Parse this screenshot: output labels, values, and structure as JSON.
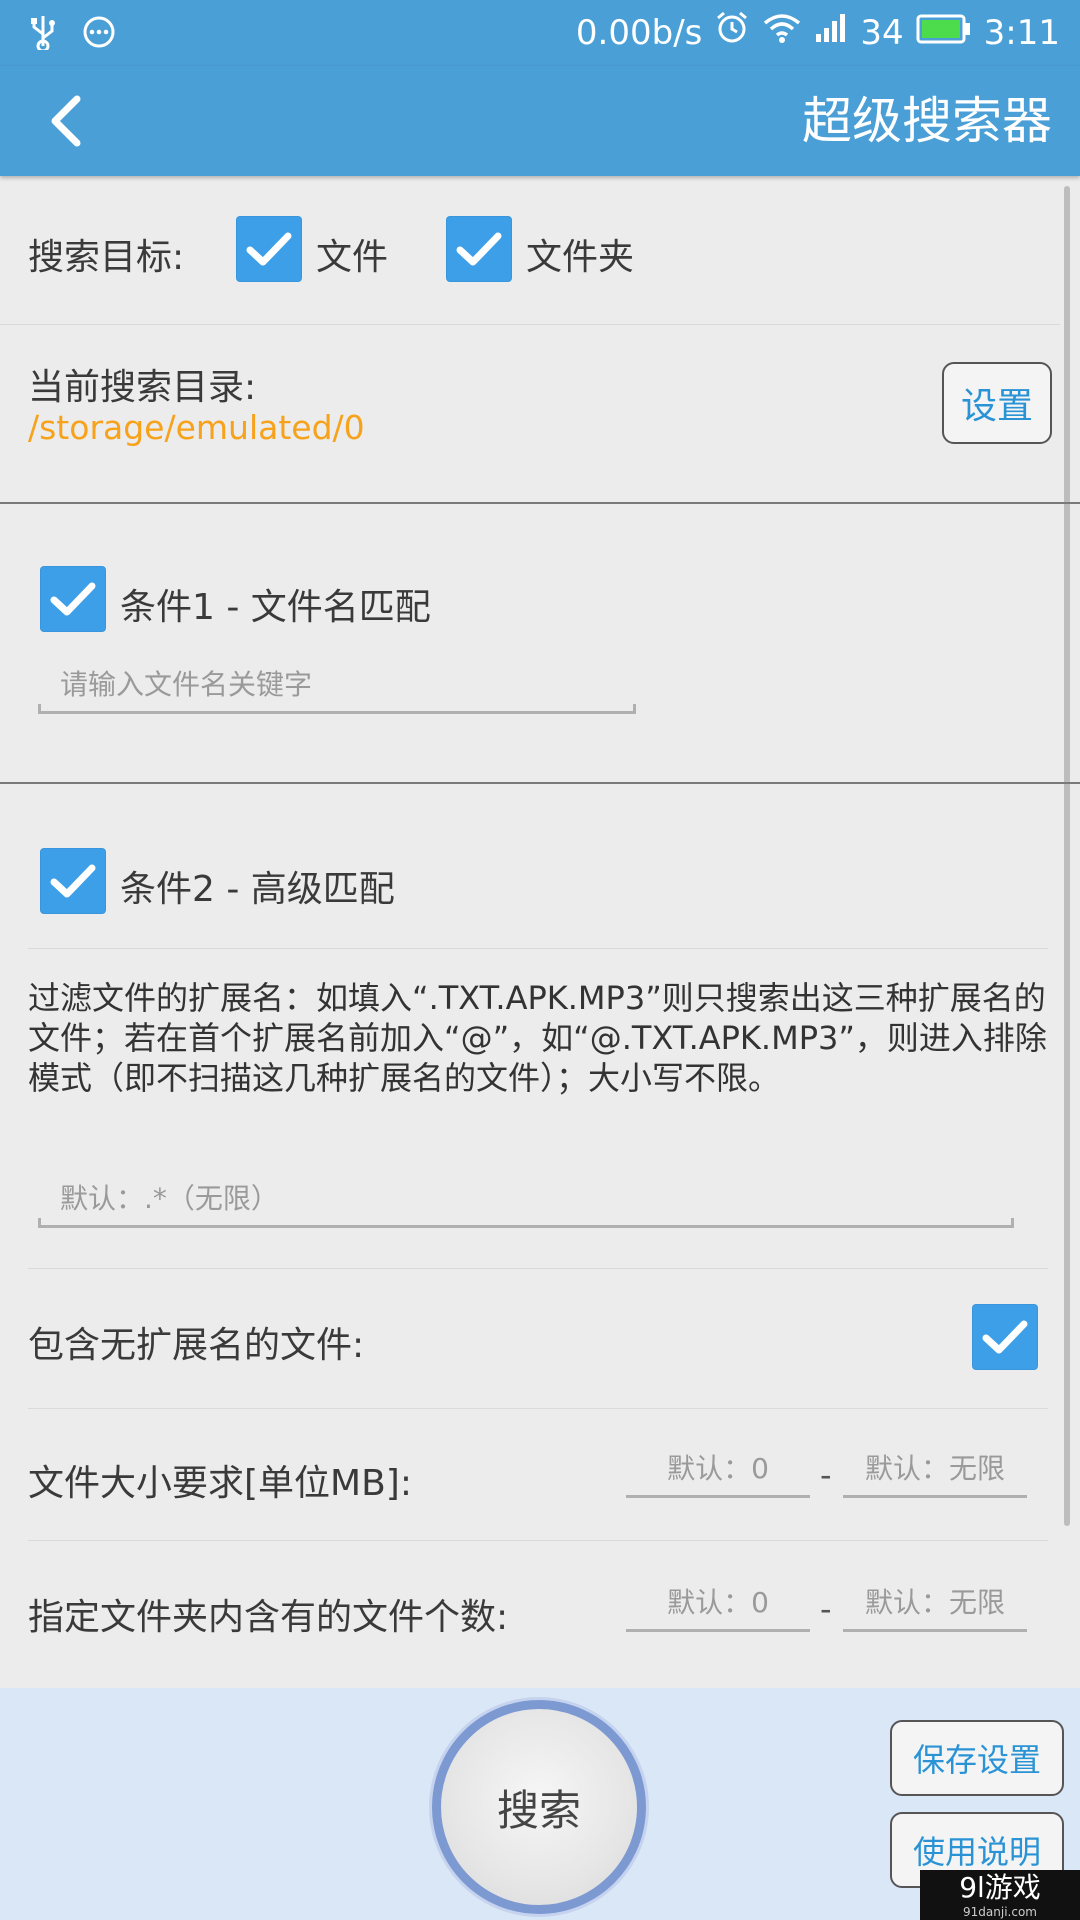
{
  "status_bar": {
    "net_speed": "0.00b/s",
    "signal_number": "34",
    "time": "3:11",
    "icons": [
      "usb-icon",
      "more-icon",
      "alarm-icon",
      "wifi-icon",
      "signal-icon",
      "battery-icon"
    ]
  },
  "toolbar": {
    "title": "超级搜索器"
  },
  "search_target": {
    "label": "搜索目标:",
    "options": [
      {
        "label": "文件",
        "checked": true
      },
      {
        "label": "文件夹",
        "checked": true
      }
    ]
  },
  "directory": {
    "label": "当前搜索目录:",
    "path": "/storage/emulated/0",
    "set_button": "设置"
  },
  "condition1": {
    "label": "条件1 - 文件名匹配",
    "checked": true,
    "placeholder": "请输入文件名关键字"
  },
  "condition2": {
    "label": "条件2 - 高级匹配",
    "checked": true,
    "description": "过滤文件的扩展名：如填入“.TXT.APK.MP3”则只搜索出这三种扩展名的文件；若在首个扩展名前加入“@”，如“@.TXT.APK.MP3”，则进入排除模式（即不扫描这几种扩展名的文件）；大小写不限。",
    "ext_placeholder": "默认：.*（无限）",
    "no_ext_label": "包含无扩展名的文件:",
    "no_ext_checked": true,
    "size_label": "文件大小要求[单位MB]:",
    "size_min_placeholder": "默认：0",
    "size_max_placeholder": "默认：无限",
    "count_label": "指定文件夹内含有的文件个数:",
    "count_min_placeholder": "默认：0",
    "count_max_placeholder": "默认：无限",
    "range_separator": "-"
  },
  "bottom": {
    "search_button": "搜索",
    "save_button": "保存设置",
    "help_button": "使用说明"
  },
  "watermark": {
    "brand": "9l游戏",
    "site": "91danji.com"
  },
  "colors": {
    "primary": "#4a9fd6",
    "checkbox": "#3d9fe8",
    "path": "#f7a21b",
    "button_text": "#2a93d5",
    "bottom_bar": "#d9e7f7"
  }
}
